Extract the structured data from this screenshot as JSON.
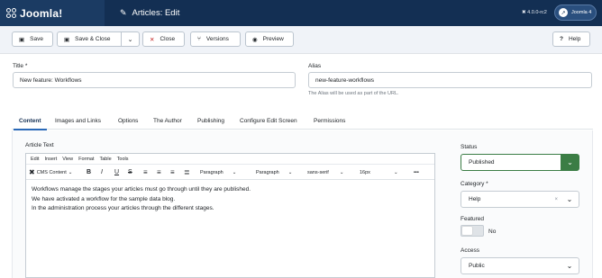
{
  "header": {
    "logo_text": "Joomla!",
    "page_title": "Articles: Edit",
    "version": "4.0.0-rc2",
    "brand_label": "Joomla 4"
  },
  "toolbar": {
    "save": "Save",
    "save_close": "Save & Close",
    "close": "Close",
    "versions": "Versions",
    "preview": "Preview",
    "help": "Help"
  },
  "fields": {
    "title_label": "Title *",
    "title_value": "New feature: Workflows",
    "alias_label": "Alias",
    "alias_value": "new-feature-workflows",
    "alias_hint": "The Alias will be used as part of the URL."
  },
  "tabs": [
    "Content",
    "Images and Links",
    "Options",
    "The Author",
    "Publishing",
    "Configure Edit Screen",
    "Permissions"
  ],
  "editor": {
    "label": "Article Text",
    "menu": [
      "Edit",
      "Insert",
      "View",
      "Format",
      "Table",
      "Tools"
    ],
    "toolbar": {
      "cms_content": "CMS Content",
      "bold": "B",
      "italic": "I",
      "underline": "U",
      "strike": "S",
      "block_format": "Paragraph",
      "paragraph2": "Paragraph",
      "font_family": "sans-serif",
      "font_size": "16px",
      "more": "•••"
    },
    "lines": [
      "Workflows manage the stages your articles must go through until they are published.",
      "We have activated a workflow for the sample data blog.",
      "In the administration process your articles through the different stages."
    ]
  },
  "sidebar": {
    "status_label": "Status",
    "status_value": "Published",
    "category_label": "Category *",
    "category_value": "Help",
    "featured_label": "Featured",
    "featured_value": "No",
    "access_label": "Access",
    "access_value": "Public"
  },
  "colors": {
    "header_bg": "#132f53",
    "status_green": "#3b7d45",
    "close_red": "#c52827",
    "tab_accent": "#2a69b8"
  }
}
